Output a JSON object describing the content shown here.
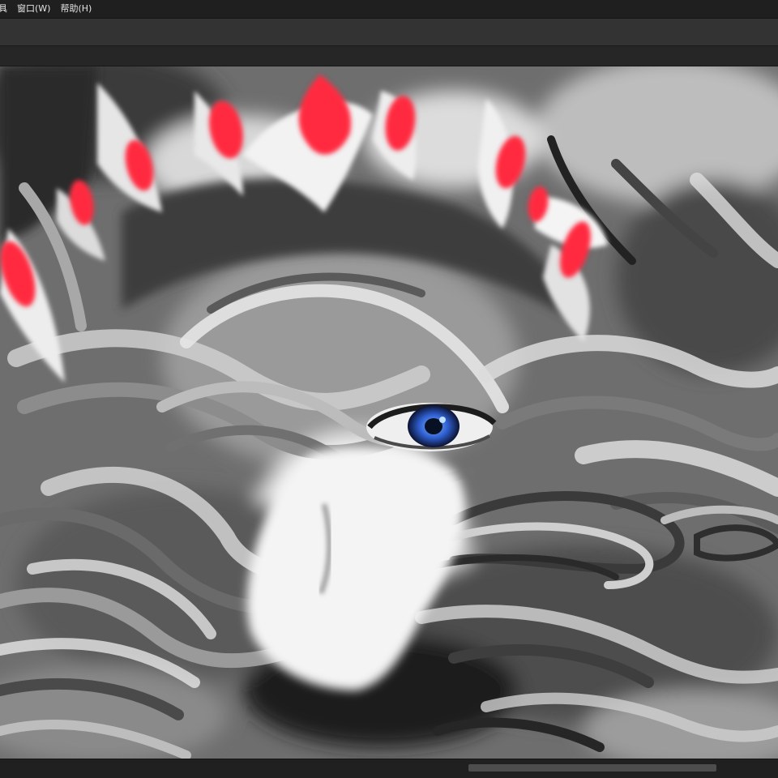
{
  "menubar": {
    "items": [
      {
        "label": "具"
      },
      {
        "label": "窗口(W)"
      },
      {
        "label": "帮助(H)"
      }
    ]
  },
  "canvas": {
    "accent_red": "#ff2a3f",
    "eye_blue": "#2f5fd0"
  }
}
